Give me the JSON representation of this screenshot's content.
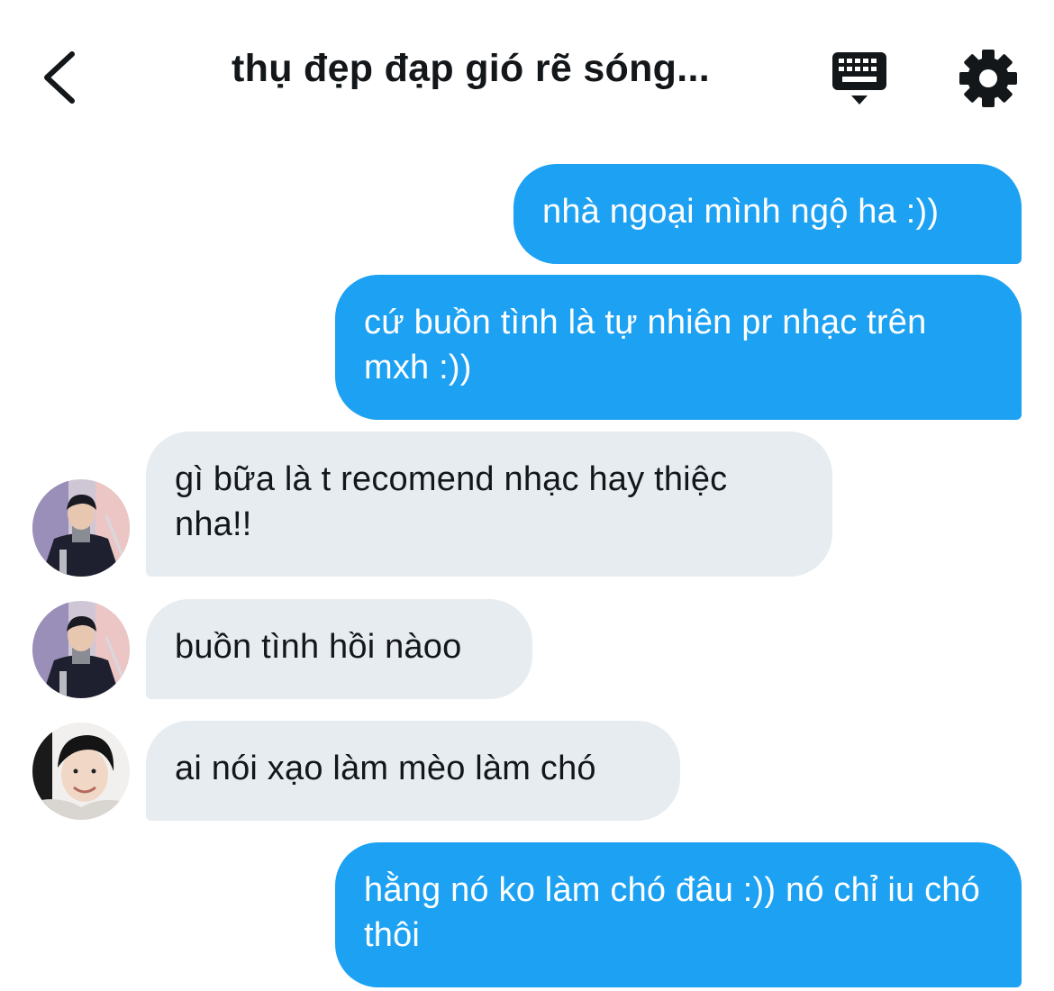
{
  "header": {
    "title": "thụ đẹp đạp gió rẽ sóng..."
  },
  "icons": {
    "back": "chevron-left-icon",
    "keyboard": "keyboard-icon",
    "settings": "gear-icon"
  },
  "colors": {
    "sent_bubble": "#1da1f2",
    "received_bubble": "#e6ecf0",
    "text": "#14171a"
  },
  "messages": [
    {
      "direction": "sent",
      "text": "nhà ngoại mình ngộ ha :))"
    },
    {
      "direction": "sent",
      "text": "cứ buồn tình là tự nhiên pr nhạc trên mxh :))"
    },
    {
      "direction": "received",
      "text": "gì bữa là t recomend nhạc hay thiệc nha!!"
    },
    {
      "direction": "received",
      "text": "buồn tình hồi nàoo"
    },
    {
      "direction": "received",
      "text": "ai nói xạo làm mèo làm chó"
    },
    {
      "direction": "sent",
      "text": "hằng nó ko làm chó đâu :)) nó chỉ iu chó thôi"
    }
  ]
}
